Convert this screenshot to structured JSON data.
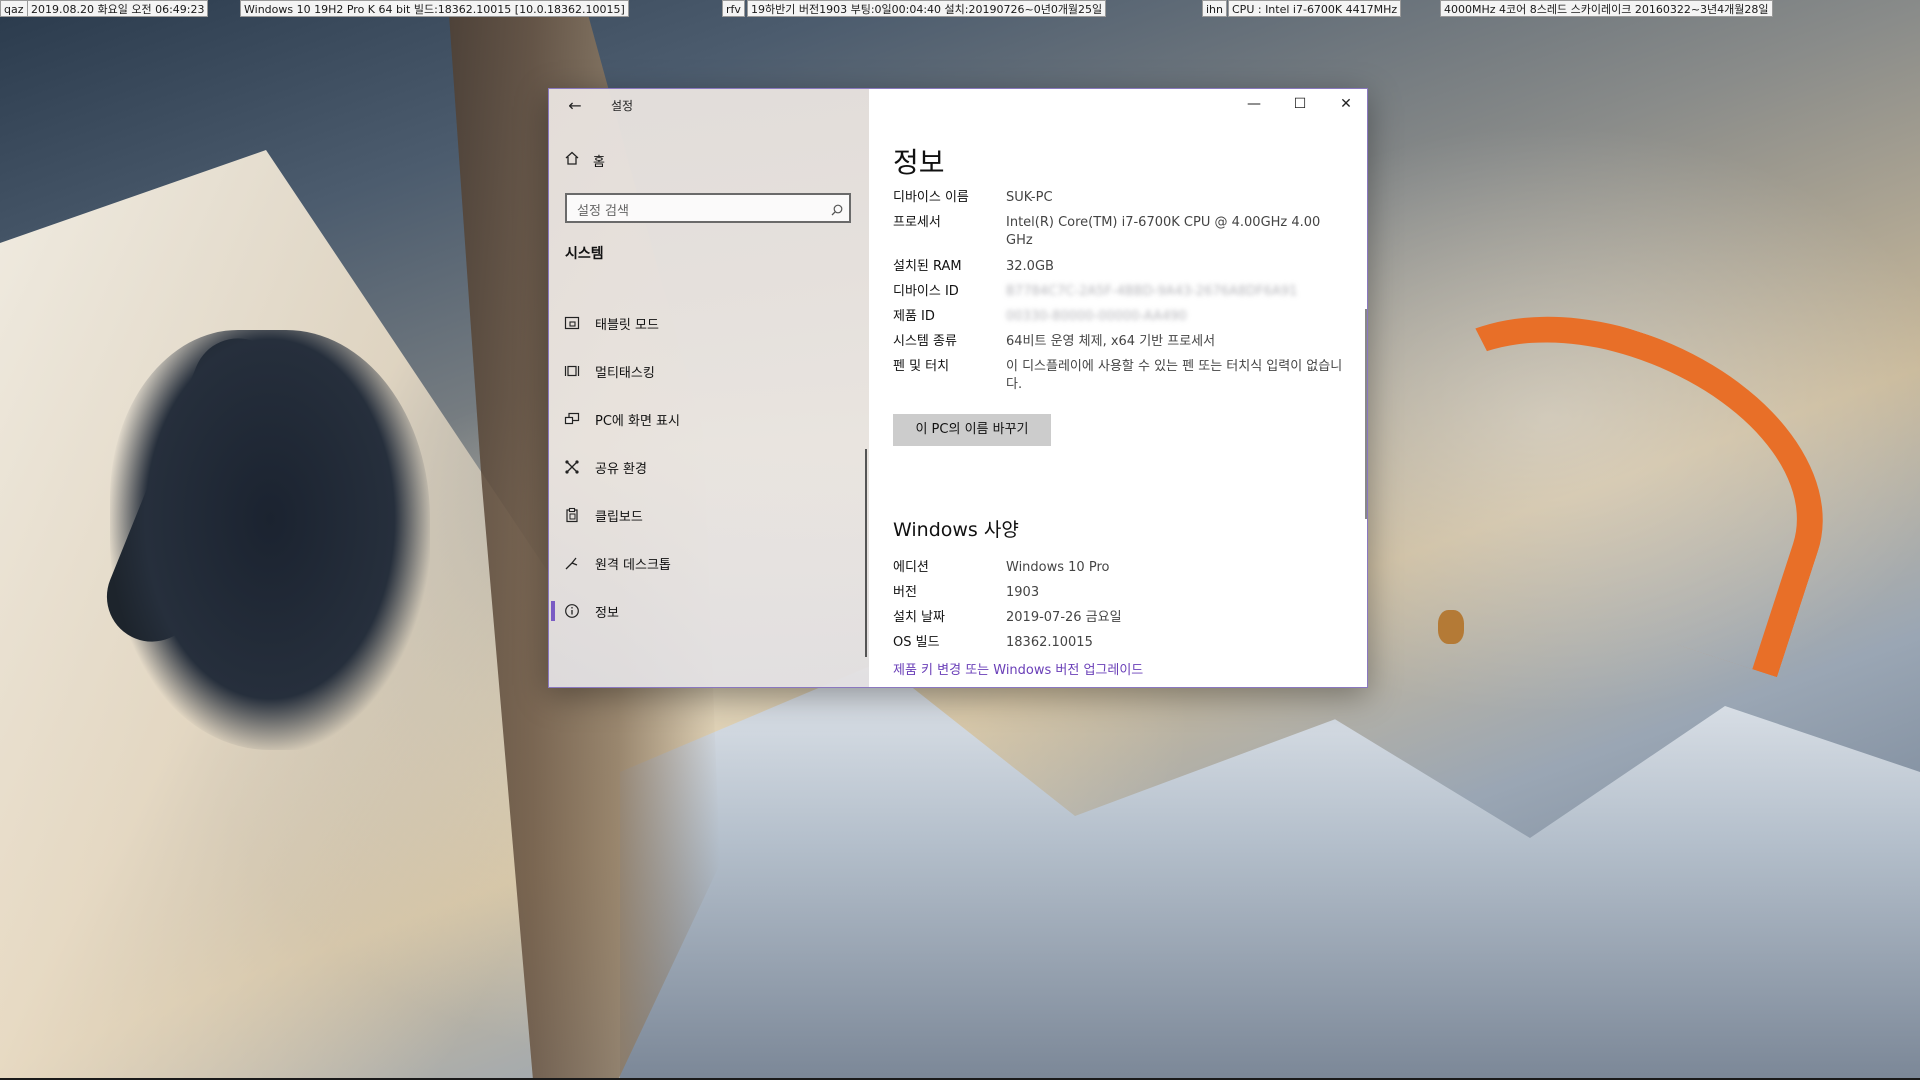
{
  "topbar": {
    "items": [
      "qaz",
      "2019.08.20 화요일 오전 06:49:23",
      "Windows 10 19H2 Pro K 64 bit 빌드:18362.10015 [10.0.18362.10015]",
      "rfv",
      "19하반기 버전1903 부팅:0일00:04:40 설치:20190726~0년0개월25일",
      "ihn",
      "CPU : Intel i7-6700K 4417MHz",
      "4000MHz 4코어 8스레드 스카이레이크 20160322~3년4개월28일"
    ]
  },
  "window": {
    "title": "설정",
    "controls": {
      "minimize": "—",
      "maximize": "☐",
      "close": "✕"
    }
  },
  "sidebar": {
    "home_label": "홈",
    "search_placeholder": "설정 검색",
    "section_title": "시스템",
    "items": [
      {
        "label": "태블릿 모드",
        "icon": "tablet-mode-icon"
      },
      {
        "label": "멀티태스킹",
        "icon": "multitasking-icon"
      },
      {
        "label": "PC에 화면 표시",
        "icon": "project-icon"
      },
      {
        "label": "공유 환경",
        "icon": "shared-experiences-icon"
      },
      {
        "label": "클립보드",
        "icon": "clipboard-icon"
      },
      {
        "label": "원격 데스크톱",
        "icon": "remote-desktop-icon"
      },
      {
        "label": "정보",
        "icon": "info-icon",
        "active": true
      }
    ]
  },
  "main": {
    "title": "정보",
    "device_specs": {
      "device_name_label": "디바이스 이름",
      "device_name": "SUK-PC",
      "processor_label": "프로세서",
      "processor": "Intel(R) Core(TM) i7-6700K CPU @ 4.00GHz   4.00 GHz",
      "ram_label": "설치된 RAM",
      "ram": "32.0GB",
      "device_id_label": "디바이스 ID",
      "device_id": "B7784C7C-2A5F-4BBD-9A43-2676A8DF6A91",
      "product_id_label": "제품 ID",
      "product_id": "00330-80000-00000-AA490",
      "system_type_label": "시스템 종류",
      "system_type": "64비트 운영 체제, x64 기반 프로세서",
      "pen_touch_label": "펜 및 터치",
      "pen_touch": "이 디스플레이에 사용할 수 있는 펜 또는 터치식 입력이 없습니다."
    },
    "rename_button": "이 PC의 이름 바꾸기",
    "windows_specs_title": "Windows 사양",
    "windows_specs": {
      "edition_label": "에디션",
      "edition": "Windows 10 Pro",
      "version_label": "버전",
      "version": "1903",
      "install_date_label": "설치 날짜",
      "install_date": "2019-07-26 금요일",
      "os_build_label": "OS 빌드",
      "os_build": "18362.10015"
    },
    "upgrade_link": "제품 키 변경 또는 Windows 버전 업그레이드"
  },
  "colors": {
    "accent": "#7a5cc4",
    "link": "#6a3fb8",
    "window_border": "#8a78c0"
  }
}
